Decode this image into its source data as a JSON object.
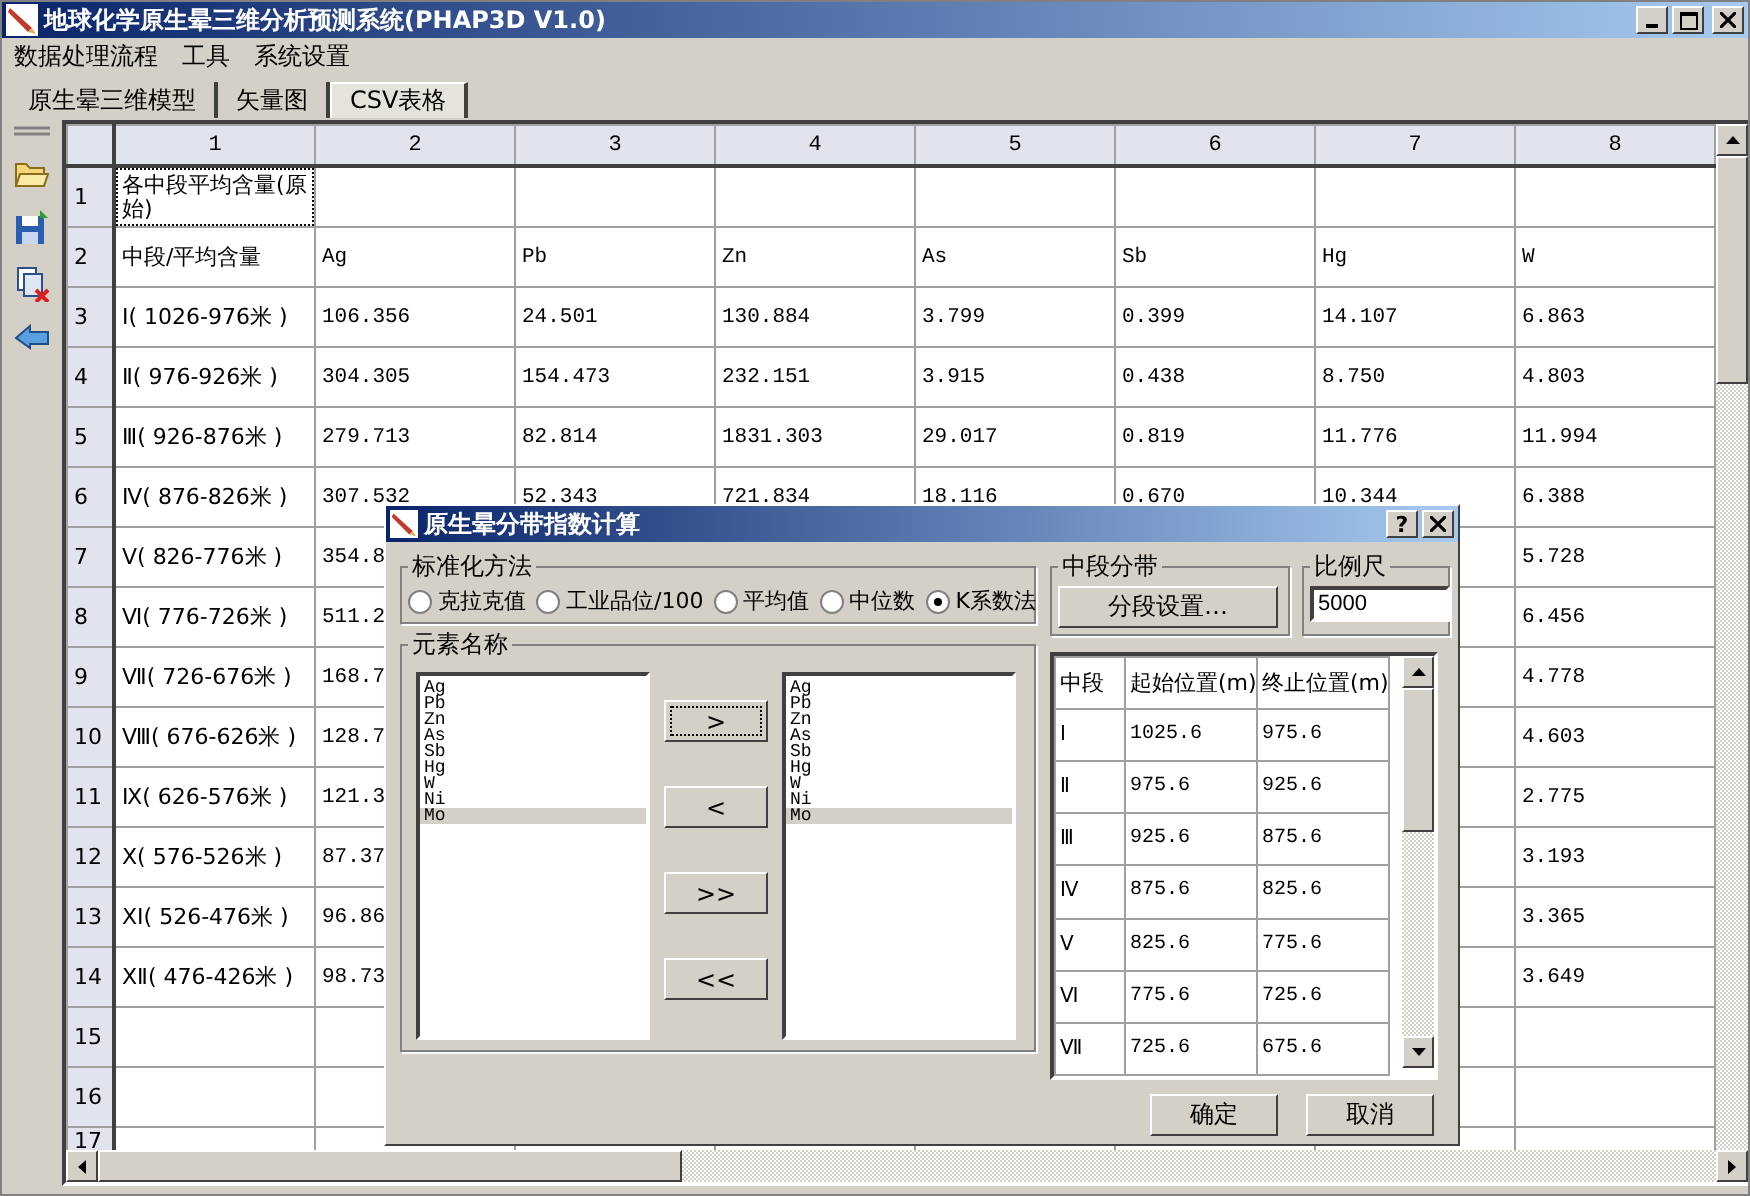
{
  "window": {
    "title": "地球化学原生晕三维分析预测系统(PHAP3D V1.0)"
  },
  "menu": [
    "数据处理流程",
    "工具",
    "系统设置"
  ],
  "tabs": [
    {
      "label": "原生晕三维模型",
      "selected": false
    },
    {
      "label": "矢量图",
      "selected": false
    },
    {
      "label": "CSV表格",
      "selected": true
    }
  ],
  "table": {
    "columns": [
      "1",
      "2",
      "3",
      "4",
      "5",
      "6",
      "7",
      "8"
    ],
    "rows": [
      {
        "header": "1",
        "cells": [
          "各中段平均含量(原始)"
        ]
      },
      {
        "header": "2",
        "cells": [
          "中段/平均含量",
          "Ag",
          "Pb",
          "Zn",
          "As",
          "Sb",
          "Hg",
          "W"
        ]
      },
      {
        "header": "3",
        "cells": [
          "Ⅰ( 1026-976米 )",
          "106.356",
          "24.501",
          "130.884",
          "3.799",
          "0.399",
          "14.107",
          "6.863"
        ]
      },
      {
        "header": "4",
        "cells": [
          "Ⅱ( 976-926米 )",
          "304.305",
          "154.473",
          "232.151",
          "3.915",
          "0.438",
          "8.750",
          "4.803"
        ]
      },
      {
        "header": "5",
        "cells": [
          "Ⅲ( 926-876米 )",
          "279.713",
          "82.814",
          "1831.303",
          "29.017",
          "0.819",
          "11.776",
          "11.994"
        ]
      },
      {
        "header": "6",
        "cells": [
          "Ⅳ( 876-826米 )",
          "307.532",
          "52.343",
          "721.834",
          "18.116",
          "0.670",
          "10.344",
          "6.388"
        ]
      },
      {
        "header": "7",
        "cells": [
          "Ⅴ( 826-776米 )",
          "354.8",
          null,
          null,
          null,
          null,
          null,
          "5.728"
        ]
      },
      {
        "header": "8",
        "cells": [
          "Ⅵ( 776-726米 )",
          "511.2",
          null,
          null,
          null,
          null,
          null,
          "6.456"
        ]
      },
      {
        "header": "9",
        "cells": [
          "Ⅶ( 726-676米 )",
          "168.7",
          null,
          null,
          null,
          null,
          null,
          "4.778"
        ]
      },
      {
        "header": "10",
        "cells": [
          "Ⅷ( 676-626米 )",
          "128.7",
          null,
          null,
          null,
          null,
          null,
          "4.603"
        ]
      },
      {
        "header": "11",
        "cells": [
          "Ⅸ( 626-576米 )",
          "121.3",
          null,
          null,
          null,
          null,
          null,
          "2.775"
        ]
      },
      {
        "header": "12",
        "cells": [
          "Ⅹ( 576-526米 )",
          "87.37",
          null,
          null,
          null,
          null,
          null,
          "3.193"
        ]
      },
      {
        "header": "13",
        "cells": [
          "ⅩⅠ( 526-476米 )",
          "96.86",
          null,
          null,
          null,
          null,
          null,
          "3.365"
        ]
      },
      {
        "header": "14",
        "cells": [
          "ⅩⅡ( 476-426米 )",
          "98.73",
          null,
          null,
          null,
          null,
          null,
          "3.649"
        ]
      },
      {
        "header": "15"
      },
      {
        "header": "16"
      },
      {
        "header": "17"
      }
    ]
  },
  "dialog": {
    "title": "原生晕分带指数计算",
    "help_button": "?",
    "normalization": {
      "label": "标准化方法",
      "options": [
        {
          "label": "克拉克值",
          "selected": false
        },
        {
          "label": "工业品位/100",
          "selected": false
        },
        {
          "label": "平均值",
          "selected": false
        },
        {
          "label": "中位数",
          "selected": false
        },
        {
          "label": "K系数法",
          "selected": true
        }
      ]
    },
    "zoning": {
      "label": "中段分带",
      "button": "分段设置…"
    },
    "scale": {
      "label": "比例尺",
      "value": "5000"
    },
    "elements": {
      "label": "元素名称",
      "source": [
        {
          "label": "Ag",
          "selected": false
        },
        {
          "label": "Pb",
          "selected": false
        },
        {
          "label": "Zn",
          "selected": false
        },
        {
          "label": "As",
          "selected": false
        },
        {
          "label": "Sb",
          "selected": false
        },
        {
          "label": "Hg",
          "selected": false
        },
        {
          "label": "W",
          "selected": false
        },
        {
          "label": "Ni",
          "selected": false
        },
        {
          "label": "Mo",
          "selected": true
        }
      ],
      "buttons": [
        ">",
        "<",
        ">>",
        "<<"
      ],
      "target": [
        {
          "label": "Ag",
          "selected": false
        },
        {
          "label": "Pb",
          "selected": false
        },
        {
          "label": "Zn",
          "selected": false
        },
        {
          "label": "As",
          "selected": false
        },
        {
          "label": "Sb",
          "selected": false
        },
        {
          "label": "Hg",
          "selected": false
        },
        {
          "label": "W",
          "selected": false
        },
        {
          "label": "Ni",
          "selected": false
        },
        {
          "label": "Mo",
          "selected": true
        }
      ]
    },
    "segments": {
      "columns": [
        "中段",
        "起始位置(m)",
        "终止位置(m)"
      ],
      "rows": [
        [
          "Ⅰ",
          "1025.6",
          "975.6"
        ],
        [
          "Ⅱ",
          "975.6",
          "925.6"
        ],
        [
          "Ⅲ",
          "925.6",
          "875.6"
        ],
        [
          "Ⅳ",
          "875.6",
          "825.6"
        ],
        [
          "Ⅴ",
          "825.6",
          "775.6"
        ],
        [
          "Ⅵ",
          "775.6",
          "725.6"
        ],
        [
          "Ⅶ",
          "725.6",
          "675.6"
        ]
      ]
    },
    "buttons": [
      "确定",
      "取消"
    ]
  }
}
